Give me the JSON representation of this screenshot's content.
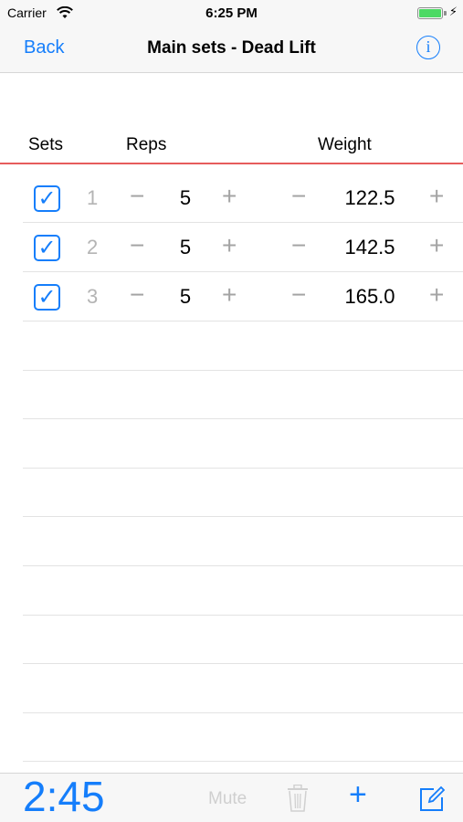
{
  "status_bar": {
    "carrier": "Carrier",
    "time": "6:25 PM"
  },
  "nav": {
    "back_label": "Back",
    "title": "Main sets - Dead Lift",
    "info_label": "i"
  },
  "headers": {
    "sets": "Sets",
    "reps": "Reps",
    "weight": "Weight"
  },
  "controls": {
    "minus": "−",
    "plus": "+",
    "check": "✓"
  },
  "sets": [
    {
      "number": "1",
      "checked": true,
      "reps": "5",
      "weight": "122.5"
    },
    {
      "number": "2",
      "checked": true,
      "reps": "5",
      "weight": "142.5"
    },
    {
      "number": "3",
      "checked": true,
      "reps": "5",
      "weight": "165.0"
    }
  ],
  "toolbar": {
    "timer": "2:45",
    "mute_label": "Mute",
    "add_label": "+"
  },
  "colors": {
    "accent": "#157efb",
    "divider": "#e65c5c",
    "battery": "#4cd964"
  }
}
